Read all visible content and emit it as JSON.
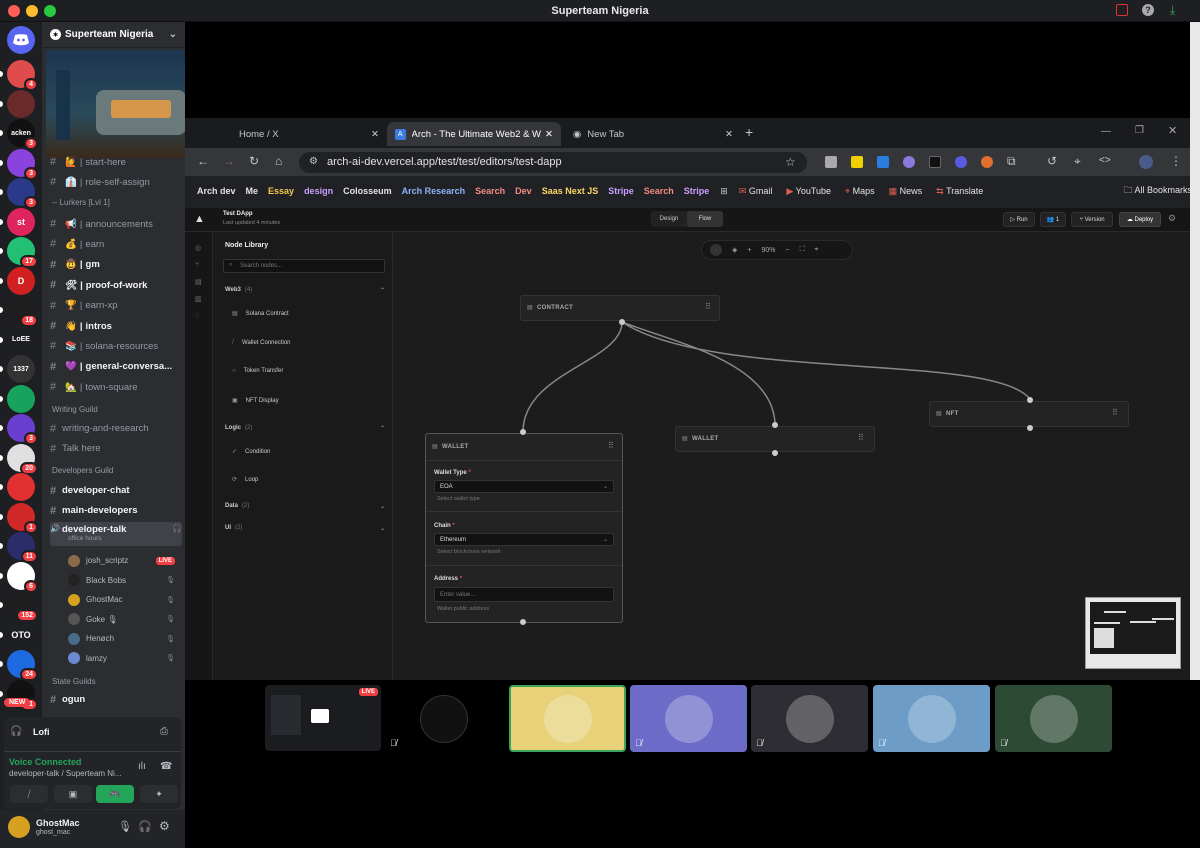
{
  "window": {
    "title": "Superteam Nigeria"
  },
  "rail": {
    "servers": [
      {
        "label": "",
        "badge": "4",
        "color": "#e04b4b"
      },
      {
        "label": "",
        "badge": "",
        "color": "#6b2a2a"
      },
      {
        "label": "acken",
        "badge": "3",
        "color": "#111"
      },
      {
        "label": "",
        "badge": "3",
        "color": "#8b43e0"
      },
      {
        "label": "",
        "badge": "3",
        "color": "#2a3a8a"
      },
      {
        "label": "st",
        "badge": "",
        "color": "#e0245e"
      },
      {
        "label": "",
        "badge": "17",
        "color": "#23c073"
      },
      {
        "label": "D",
        "badge": "",
        "color": "#d02020"
      },
      {
        "label": "",
        "badge": "18",
        "color": "#1e1e1e"
      },
      {
        "label": "LoEE",
        "badge": "",
        "color": "#1e1f22"
      },
      {
        "label": "1337",
        "badge": "",
        "color": "#333"
      },
      {
        "label": "",
        "badge": "",
        "color": "#17a35b"
      },
      {
        "label": "",
        "badge": "3",
        "color": "#6a3fd0"
      },
      {
        "label": "",
        "badge": "20",
        "color": "#e0e0e0"
      },
      {
        "label": "",
        "badge": "",
        "color": "#e03030"
      },
      {
        "label": "",
        "badge": "1",
        "color": "#d02828"
      },
      {
        "label": "",
        "badge": "11",
        "color": "#2a2d6a"
      },
      {
        "label": "",
        "badge": "6",
        "color": "#ffffff"
      },
      {
        "label": "",
        "badge": "152",
        "color": "#1e1e1e"
      },
      {
        "label": "OTO",
        "badge": "",
        "color": "#1e1f22"
      },
      {
        "label": "",
        "badge": "24",
        "color": "#1e6ae0"
      },
      {
        "label": "",
        "badge": "31",
        "color": "#111"
      }
    ],
    "new_badge": "NEW"
  },
  "sidebar": {
    "server_name": "Superteam Nigeria",
    "channels_top": [
      {
        "emoji": "🙋",
        "name": "start-here"
      },
      {
        "emoji": "👔",
        "name": "role-self-assign"
      }
    ],
    "lurkers_label": "-- Lurkers [Lvl 1]",
    "lurkers": [
      {
        "emoji": "📢",
        "name": "announcements",
        "bold": false
      },
      {
        "emoji": "💰",
        "name": "earn",
        "bold": false
      },
      {
        "emoji": "🤠",
        "name": "gm",
        "bold": true
      },
      {
        "emoji": "🛠",
        "name": "proof-of-work",
        "bold": true
      },
      {
        "emoji": "🏆",
        "name": "earn-xp",
        "bold": false
      },
      {
        "emoji": "👋",
        "name": "intros",
        "bold": true
      },
      {
        "emoji": "📚",
        "name": "solana-resources",
        "bold": false
      },
      {
        "emoji": "💜",
        "name": "general-conversa...",
        "bold": true
      },
      {
        "emoji": "🏡",
        "name": "town-square",
        "bold": false
      }
    ],
    "writing_label": "Writing Guild",
    "writing": [
      "writing-and-research",
      "Talk here"
    ],
    "developers_label": "Developers Guild",
    "developers": [
      "developer-chat",
      "main-developers"
    ],
    "voice_channel": "developer-talk",
    "voice_sub": "office hours",
    "voice_users": [
      {
        "name": "josh_scriptz",
        "live": "LIVE",
        "color": "#8a6a4a"
      },
      {
        "name": "Black Bobs",
        "live": "",
        "color": "#222"
      },
      {
        "name": "GhostMac",
        "live": "",
        "color": "#d6a020"
      },
      {
        "name": "Goke 🎙",
        "live": "",
        "color": "#555"
      },
      {
        "name": "Henøch",
        "live": "",
        "color": "#4a6a8a"
      },
      {
        "name": "lamzy",
        "live": "",
        "color": "#6b8ad0"
      }
    ],
    "state_label": "State Guilds",
    "state_first": "ogun"
  },
  "voice": {
    "activity": "Lofi",
    "status": "Voice Connected",
    "channel": "developer-talk / Superteam Ni..."
  },
  "user": {
    "name": "GhostMac",
    "handle": "ghost_mac"
  },
  "browser": {
    "tabs": [
      {
        "title": "Home / X"
      },
      {
        "title": "Arch - The Ultimate Web2 & W"
      },
      {
        "title": "New Tab"
      }
    ],
    "url": "arch-ai-dev.vercel.app/test/test/editors/test-dapp",
    "bookmarks": [
      {
        "label": "Arch dev",
        "color": "#e3e3e3"
      },
      {
        "label": "Me",
        "color": "#e3e3e3"
      },
      {
        "label": "Essay",
        "color": "#f2c94c"
      },
      {
        "label": "design",
        "color": "#c9a0ff"
      },
      {
        "label": "Colosseum",
        "color": "#e3e3e3"
      },
      {
        "label": "Arch Research",
        "color": "#8ab4f8"
      },
      {
        "label": "Search",
        "color": "#f28b82"
      },
      {
        "label": "Dev",
        "color": "#f28b82"
      },
      {
        "label": "Saas Next JS",
        "color": "#fdd663"
      },
      {
        "label": "Stripe",
        "color": "#c9a0ff"
      },
      {
        "label": "Search",
        "color": "#f28b82"
      },
      {
        "label": "Stripe",
        "color": "#c9a0ff"
      }
    ],
    "bookmarks_plain": [
      "Gmail",
      "YouTube",
      "Maps",
      "News",
      "Translate"
    ],
    "all_bookmarks": "All Bookmarks"
  },
  "editor": {
    "project": "Test DApp",
    "updated": "Last updated 4 minutes",
    "modes": [
      "Design",
      "Flow"
    ],
    "run": "Run",
    "users": "1",
    "version": "Version",
    "deploy": "Deploy",
    "zoom": "90%",
    "library_title": "Node Library",
    "search_placeholder": "Search nodes...",
    "sections": [
      {
        "name": "Web3",
        "count": "(4)"
      },
      {
        "name": "Logic",
        "count": "(2)"
      },
      {
        "name": "Data",
        "count": "(2)"
      },
      {
        "name": "UI",
        "count": "(2)"
      }
    ],
    "web3_items": [
      "Solana Contract",
      "Wallet Connection",
      "Token Transfer",
      "NFT Display"
    ],
    "logic_items": [
      "Condition",
      "Loop"
    ],
    "nodes": {
      "contract": "CONTRACT",
      "wallet1": "WALLET",
      "wallet2": "WALLET",
      "nft": "NFT"
    },
    "wallet_form": {
      "type_label": "Wallet Type",
      "type_value": "EOA",
      "type_help": "Select wallet type",
      "chain_label": "Chain",
      "chain_value": "Ethereum",
      "chain_help": "Select blockchain network",
      "address_label": "Address",
      "address_placeholder": "Enter value...",
      "address_help": "Wallet public address"
    }
  },
  "call": {
    "live": "LIVE",
    "tiles": [
      {
        "name": "Black Bobs",
        "bg": "#000000"
      },
      {
        "name": "GhostMac",
        "bg": "#e7d27a"
      },
      {
        "name": "lamzy",
        "bg": "#6c6cc8"
      },
      {
        "name": "Goke",
        "bg": "#2e2d33"
      },
      {
        "name": "Henøch",
        "bg": "#6d9cc7"
      },
      {
        "name": "user",
        "bg": "#2d4a34"
      }
    ]
  }
}
